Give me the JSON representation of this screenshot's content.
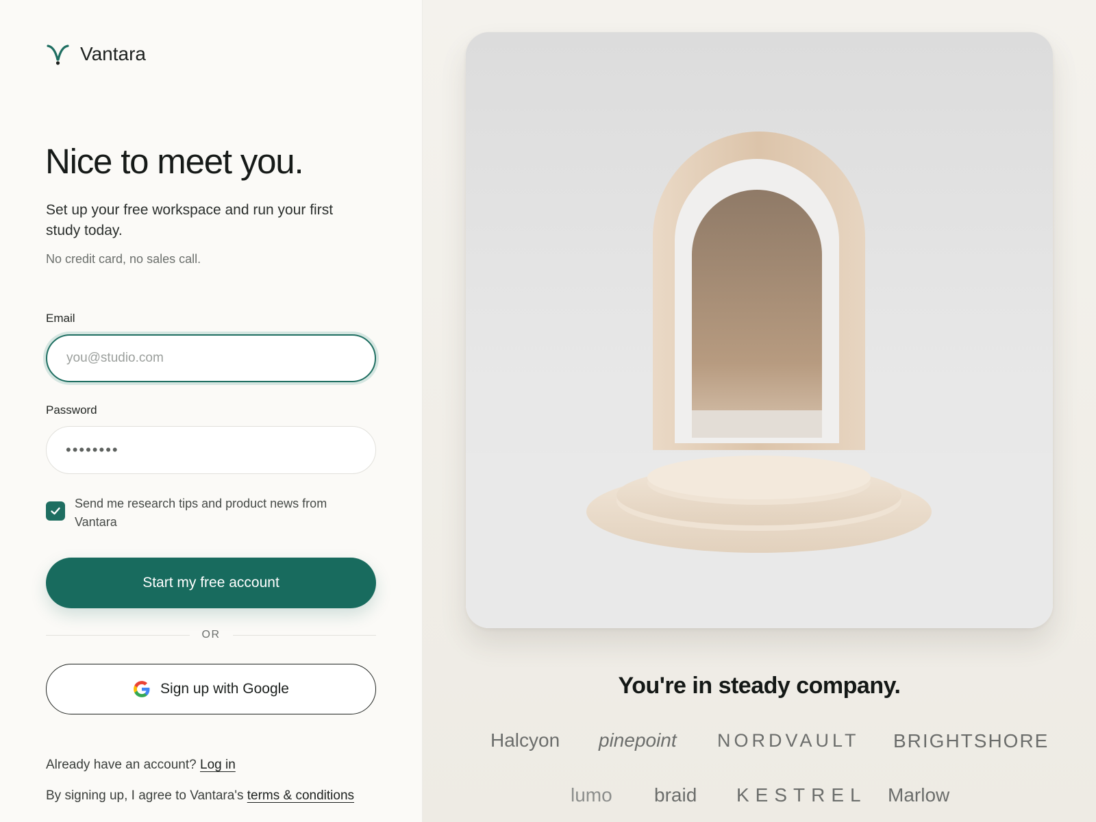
{
  "brand": {
    "name": "Vantara",
    "accent_color": "#1e6e61",
    "logo_icon": "v-sprout-icon"
  },
  "signup": {
    "headline": "Nice to meet you.",
    "subtitle": "Set up your free workspace and run your first study today.",
    "note": "No credit card, no sales call.",
    "email": {
      "label": "Email",
      "placeholder": "you@studio.com",
      "value": ""
    },
    "password": {
      "label": "Password",
      "value": "••••••••"
    },
    "newsletter": {
      "checked": true,
      "label": "Send me research tips and product news from Vantara"
    },
    "submit_label": "Start my free account",
    "divider_label": "OR",
    "google_label": "Sign up with Google",
    "login_prompt": "Already have an account?",
    "login_link": "Log in",
    "terms_prompt": "By signing up, I agree to Vantara's",
    "terms_link": "terms & conditions"
  },
  "showcase": {
    "company_title": "You're in steady company.",
    "logos": [
      "Halcyon",
      "pinepoint",
      "NORDVAULT",
      "BRIGHTSHORE",
      "lumo",
      "braid",
      "KESTREL",
      "Marlow"
    ]
  }
}
